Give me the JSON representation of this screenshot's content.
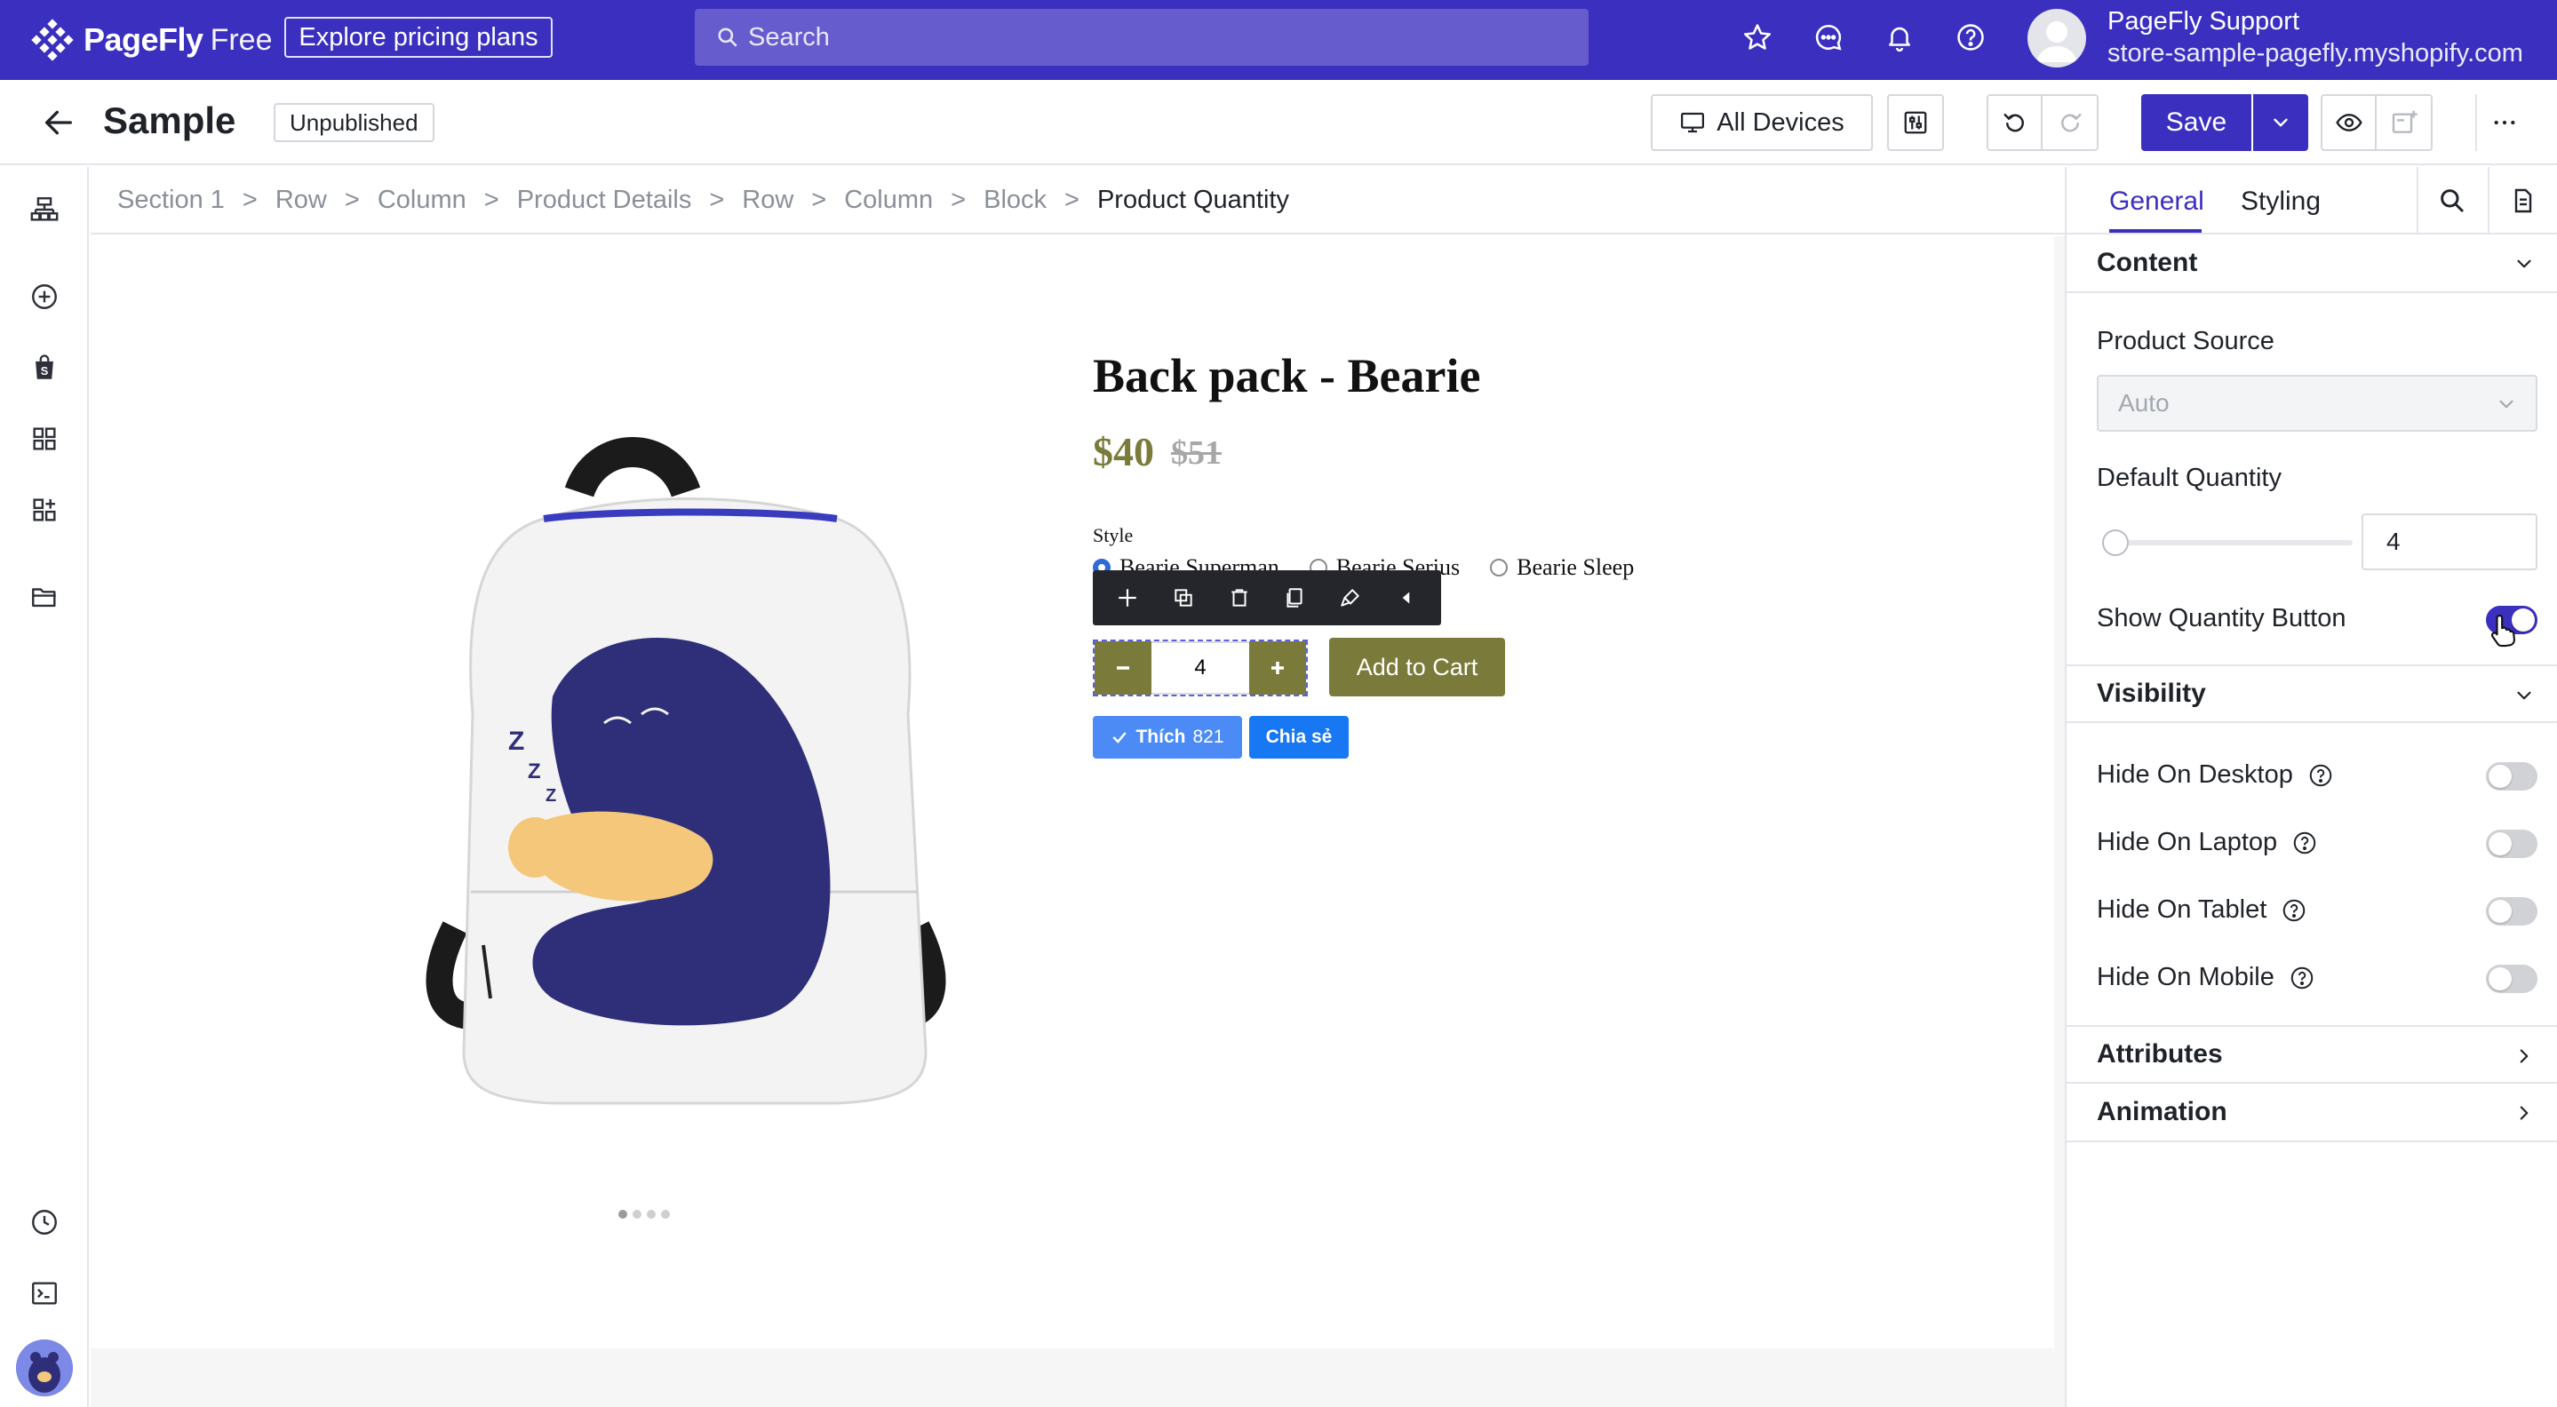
{
  "topbar": {
    "brand": "PageFly",
    "plan": "Free",
    "pricing_label": "Explore pricing plans",
    "search_placeholder": "Search",
    "user_name": "PageFly Support",
    "store_domain": "store-sample-pagefly.myshopify.com"
  },
  "editor": {
    "page_name": "Sample",
    "status": "Unpublished",
    "devices_label": "All Devices",
    "save_label": "Save"
  },
  "breadcrumb": [
    "Section 1",
    "Row",
    "Column",
    "Product Details",
    "Row",
    "Column",
    "Block",
    "Product Quantity"
  ],
  "breadcrumb_separator": ">",
  "product": {
    "title": "Back pack - Bearie",
    "price": "$40",
    "compare_price": "$51",
    "style_label": "Style",
    "options": [
      "Bearie Superman",
      "Bearie Serius",
      "Bearie Sleep"
    ],
    "selected_option": "Bearie Superman",
    "quantity": "4",
    "add_to_cart_label": "Add to Cart",
    "like_label": "Thích",
    "like_count": "821",
    "share_label": "Chia sẻ",
    "image_slides": 4,
    "active_slide": 1
  },
  "panel": {
    "tabs": [
      "General",
      "Styling"
    ],
    "active_tab": "General",
    "sections": {
      "content": "Content",
      "visibility": "Visibility",
      "attributes": "Attributes",
      "animation": "Animation"
    },
    "product_source_label": "Product Source",
    "product_source_value": "Auto",
    "default_quantity_label": "Default Quantity",
    "default_quantity_value": "4",
    "show_quantity_button_label": "Show Quantity Button",
    "show_quantity_button": true,
    "visibility_toggles": [
      {
        "label": "Hide On Desktop",
        "on": false
      },
      {
        "label": "Hide On Laptop",
        "on": false
      },
      {
        "label": "Hide On Tablet",
        "on": false
      },
      {
        "label": "Hide On Mobile",
        "on": false
      }
    ]
  },
  "colors": {
    "brand": "#3b2fc0",
    "product_accent": "#7a7a3a",
    "facebook_blue": "#1877f2",
    "selection_dashed": "#5b5fe0"
  },
  "icons": {
    "topbar": [
      "star-icon",
      "chat-icon",
      "bell-icon",
      "help-icon"
    ],
    "left_rail": [
      "layers-icon",
      "add-circle-icon",
      "shopify-bag-icon",
      "grid-icon",
      "add-grid-icon",
      "folder-icon",
      "history-icon",
      "terminal-icon"
    ],
    "toolbar": [
      "move-icon",
      "duplicate-icon",
      "trash-icon",
      "copy-icon",
      "paint-icon",
      "collapse-icon"
    ]
  }
}
